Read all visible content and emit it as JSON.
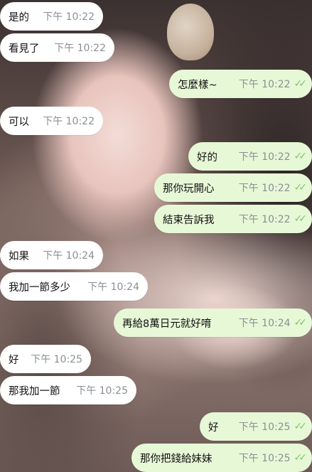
{
  "messages": [
    {
      "side": "in",
      "text": "是的",
      "time": "下午 10:22"
    },
    {
      "side": "in",
      "text": "看見了",
      "time": "下午 10:22"
    },
    {
      "side": "out",
      "text": "怎麼樣~",
      "time": "下午 10:22",
      "read": true
    },
    {
      "side": "in",
      "text": "可以",
      "time": "下午 10:22"
    },
    {
      "side": "out",
      "text": "好的",
      "time": "下午 10:22",
      "read": true
    },
    {
      "side": "out",
      "text": "那你玩開心",
      "time": "下午 10:22",
      "read": true
    },
    {
      "side": "out",
      "text": "結束告訴我",
      "time": "下午 10:22",
      "read": true
    },
    {
      "side": "in",
      "text": "如果",
      "time": "下午 10:24"
    },
    {
      "side": "in",
      "text": "我加一節多少",
      "time": "下午 10:24"
    },
    {
      "side": "out",
      "text": "再給8萬日元就好唷",
      "time": "下午 10:24",
      "read": true
    },
    {
      "side": "in",
      "text": "好",
      "time": "下午 10:25"
    },
    {
      "side": "in",
      "text": "那我加一節",
      "time": "下午 10:25"
    },
    {
      "side": "out",
      "text": "好",
      "time": "下午 10:25",
      "read": true
    },
    {
      "side": "out",
      "text": "那你把錢給妹妹",
      "time": "下午 10:25",
      "read": true
    }
  ],
  "colors": {
    "incoming_bubble": "#ffffff",
    "outgoing_bubble": "#e7f8d7",
    "read_check": "#7cc86a",
    "time_text": "#8a8f93"
  },
  "icons": {
    "read": "double-check-icon"
  }
}
